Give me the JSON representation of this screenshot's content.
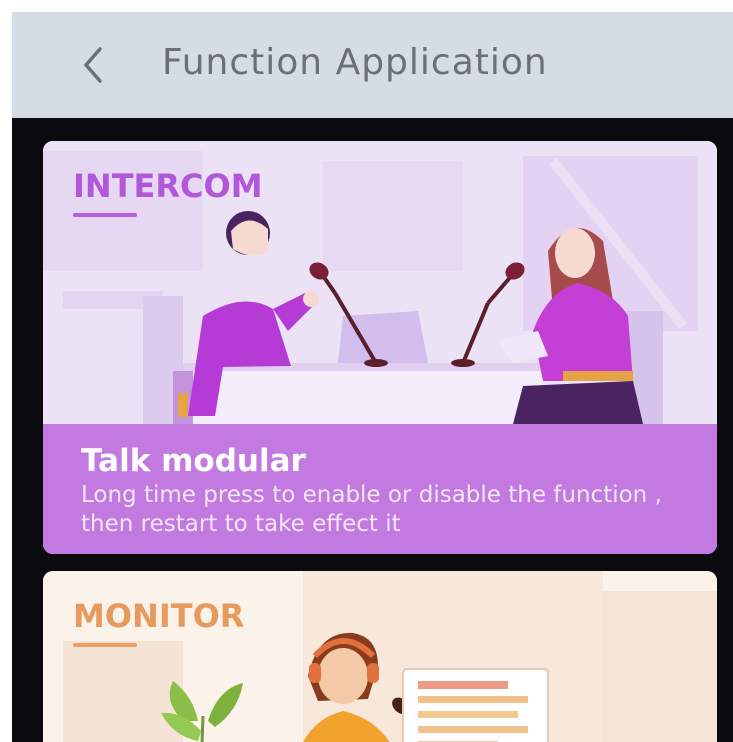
{
  "header": {
    "title": "Function Application",
    "back_icon": "chevron-left-icon",
    "background": "#d6dce5"
  },
  "cards": [
    {
      "label": "INTERCOM",
      "title": "Talk modular",
      "description": "Long time press to enable or disable the function , then restart to take effect it",
      "accent": "#b257d9",
      "band_color": "#c27ae0"
    },
    {
      "label": "MONITOR",
      "accent": "#e79a5d"
    }
  ]
}
